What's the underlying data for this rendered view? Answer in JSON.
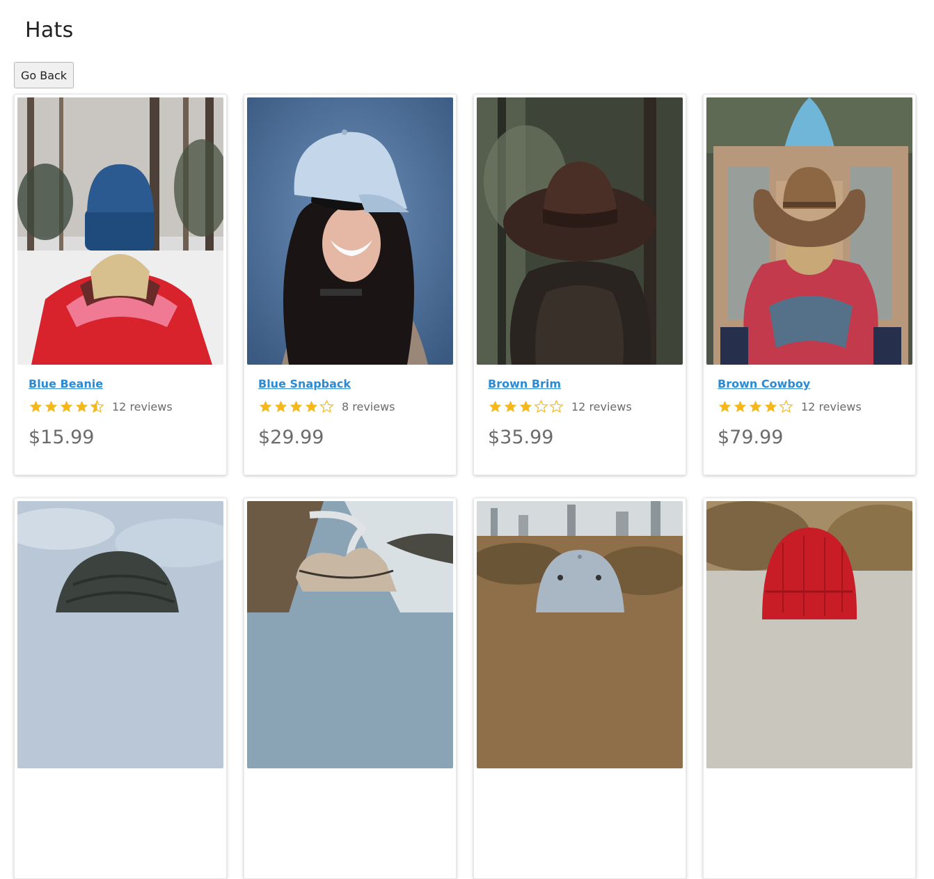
{
  "page": {
    "title": "Hats"
  },
  "toolbar": {
    "back_label": "Go Back"
  },
  "colors": {
    "link": "#2a8ad4",
    "star": "#f5b81a",
    "muted": "#6b6b6b"
  },
  "products": [
    {
      "name": "Blue Beanie",
      "rating": 4.5,
      "reviews": "12 reviews",
      "price": "$15.99"
    },
    {
      "name": "Blue Snapback",
      "rating": 4,
      "reviews": "8 reviews",
      "price": "$29.99"
    },
    {
      "name": "Brown Brim",
      "rating": 3,
      "reviews": "12 reviews",
      "price": "$35.99"
    },
    {
      "name": "Brown Cowboy",
      "rating": 4,
      "reviews": "12 reviews",
      "price": "$79.99"
    },
    {
      "name": "",
      "rating": null,
      "reviews": "",
      "price": ""
    },
    {
      "name": "",
      "rating": null,
      "reviews": "",
      "price": ""
    },
    {
      "name": "",
      "rating": null,
      "reviews": "",
      "price": ""
    },
    {
      "name": "",
      "rating": null,
      "reviews": "",
      "price": ""
    }
  ]
}
